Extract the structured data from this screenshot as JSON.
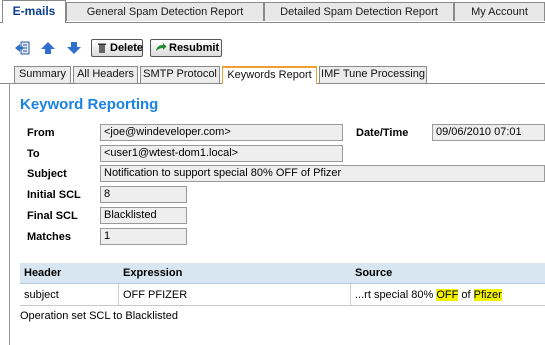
{
  "top_tabs": [
    {
      "label": "E-mails",
      "active": true
    },
    {
      "label": "General Spam Detection Report",
      "active": false
    },
    {
      "label": "Detailed Spam Detection Report",
      "active": false
    },
    {
      "label": "My Account",
      "active": false
    }
  ],
  "toolbar": {
    "delete_label": "Delete",
    "resubmit_label": "Resubmit"
  },
  "sub_tabs": [
    {
      "label": "Summary",
      "active": false
    },
    {
      "label": "All Headers",
      "active": false
    },
    {
      "label": "SMTP Protocol",
      "active": false
    },
    {
      "label": "Keywords Report",
      "active": true
    },
    {
      "label": "IMF Tune Processing",
      "active": false
    }
  ],
  "report": {
    "title": "Keyword Reporting",
    "from_label": "From",
    "from_value": "<joe@windeveloper.com>",
    "datetime_label": "Date/Time",
    "datetime_value": "09/06/2010 07:01",
    "to_label": "To",
    "to_value": "<user1@wtest-dom1.local>",
    "subject_label": "Subject",
    "subject_value": "Notification to support special 80% OFF of Pfizer",
    "initial_scl_label": "Initial SCL",
    "initial_scl_value": "8",
    "final_scl_label": "Final SCL",
    "final_scl_value": "Blacklisted",
    "matches_label": "Matches",
    "matches_value": "1"
  },
  "table": {
    "headers": [
      "Header",
      "Expression",
      "Source"
    ],
    "row": {
      "header": "subject",
      "expression": "OFF PFIZER",
      "source_prefix": "...rt special 80% ",
      "source_hl1": "OFF",
      "source_mid": " of ",
      "source_hl2": "Pfizer"
    },
    "footer": "Operation set SCL to Blacklisted"
  },
  "colors": {
    "heading": "#1a82e2",
    "highlight": "#f2f200",
    "table_header_bg": "#d8e6f1"
  }
}
